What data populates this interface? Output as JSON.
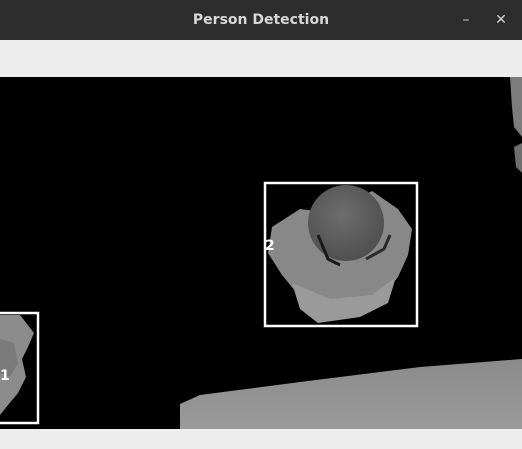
{
  "window": {
    "title": "Person Detection",
    "minimize_glyph": "–",
    "close_glyph": "✕"
  },
  "detections": [
    {
      "label": "1"
    },
    {
      "label": "2"
    }
  ],
  "colors": {
    "box": "#ffffff",
    "background": "#000000",
    "person_depth": "#7a7a7a"
  }
}
